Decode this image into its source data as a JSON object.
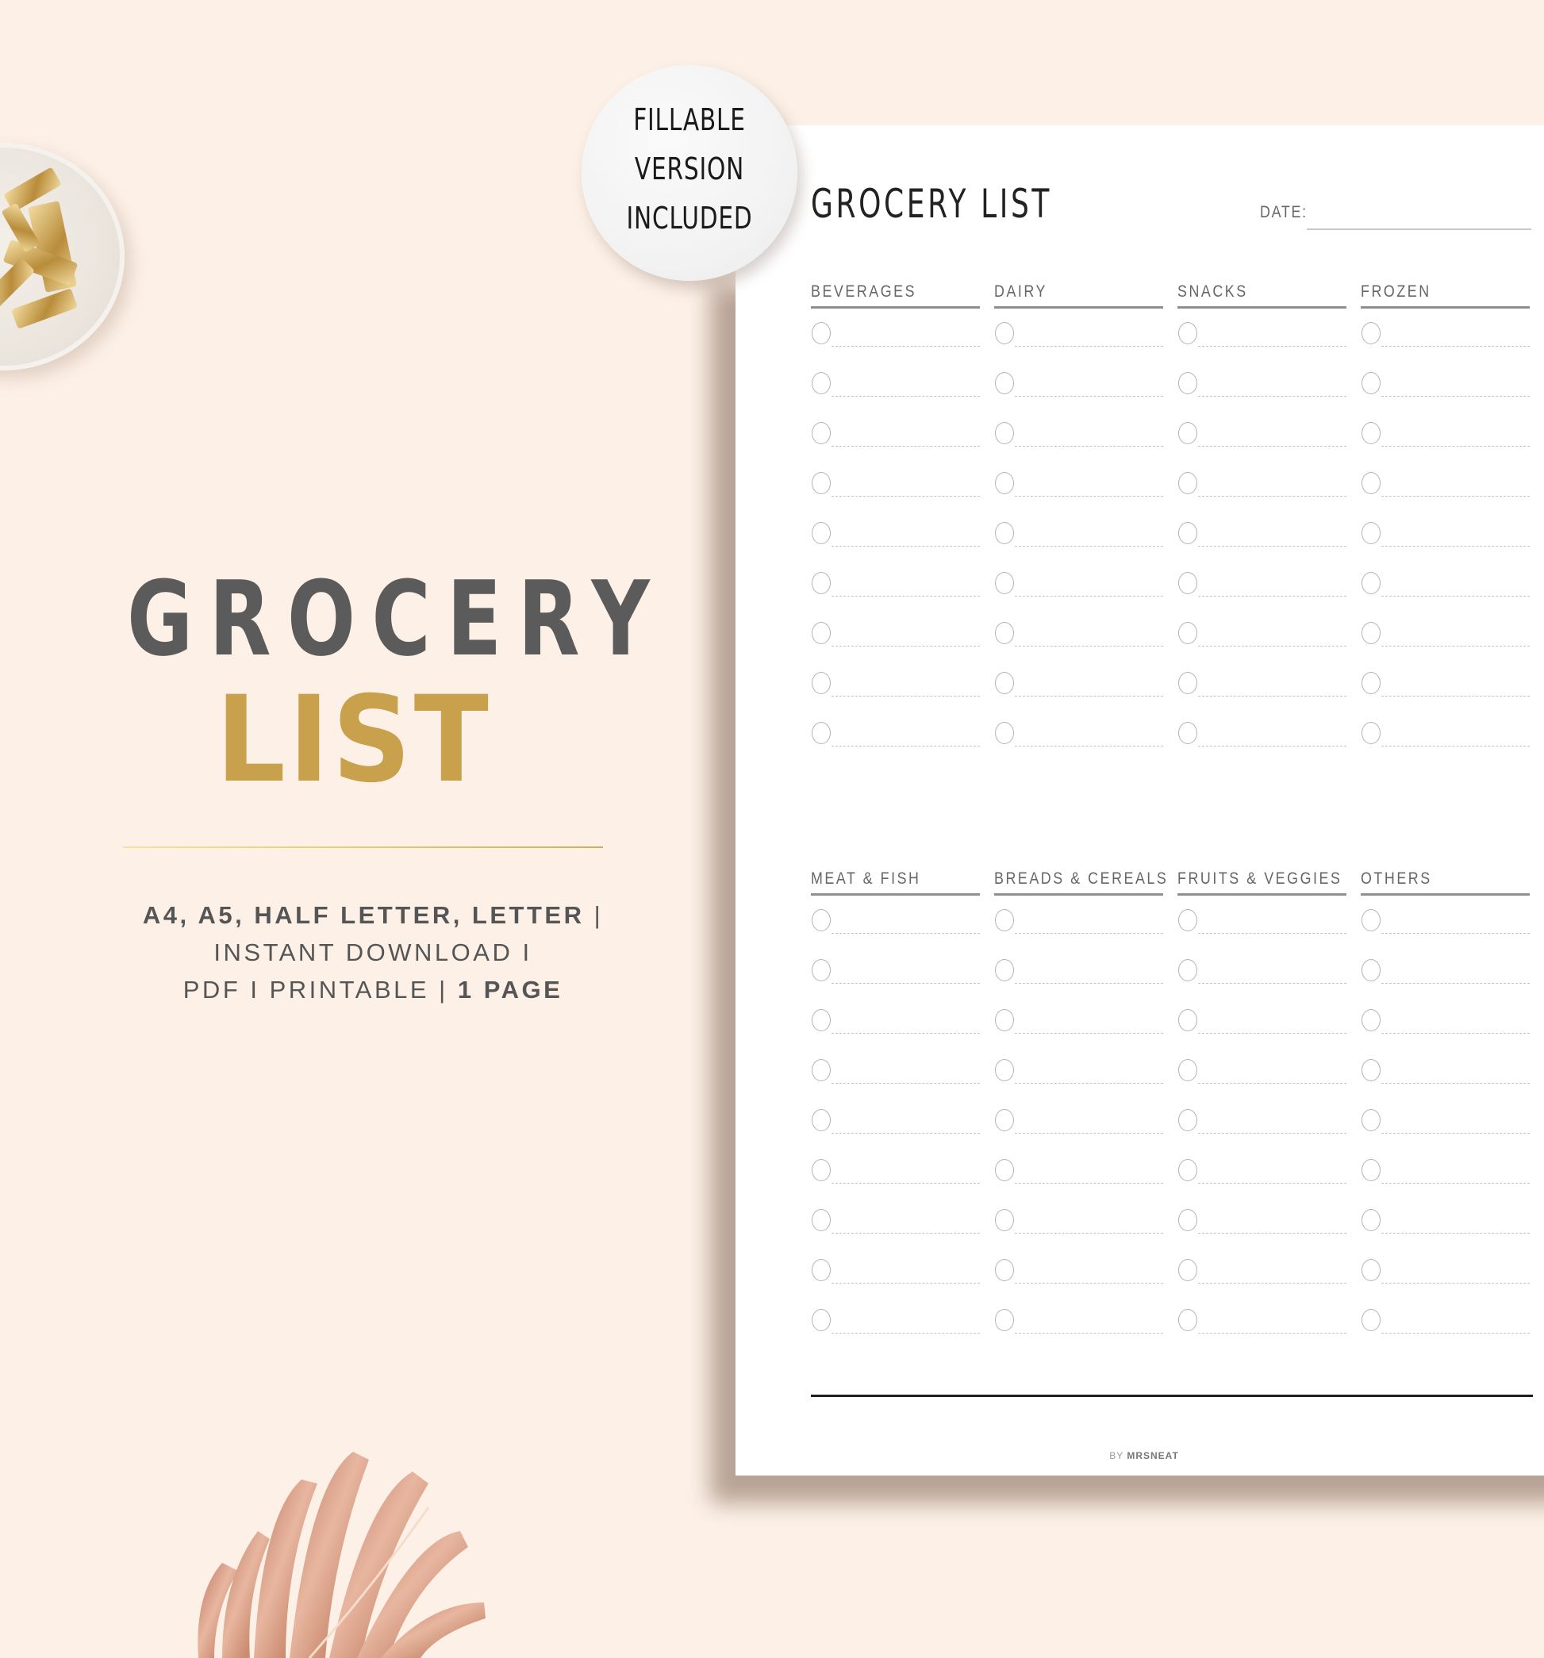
{
  "hero": {
    "title_line1": "GROCERY",
    "title_line2": "LIST",
    "formats_line1_bold": "A4, A5, HALF LETTER, LETTER",
    "formats_line1_sep": " |",
    "formats_line2": "INSTANT DOWNLOAD I",
    "formats_line3": "PDF I PRINTABLE | ",
    "formats_line3_bold": "1 PAGE",
    "accent_color": "#c9a04c",
    "title_color": "#5b5b5b"
  },
  "sticker": {
    "line1": "FILLABLE",
    "line2": "VERSION",
    "line3": "INCLUDED"
  },
  "planner": {
    "title": "GROCERY LIST",
    "date_label": "DATE:",
    "sections": [
      {
        "columns": [
          {
            "label": "BEVERAGES",
            "rows": 9
          },
          {
            "label": "DAIRY",
            "rows": 9
          },
          {
            "label": "SNACKS",
            "rows": 9
          },
          {
            "label": "FROZEN",
            "rows": 9
          }
        ]
      },
      {
        "columns": [
          {
            "label": "MEAT & FISH",
            "rows": 9
          },
          {
            "label": "BREADS & CEREALS",
            "rows": 9
          },
          {
            "label": "FRUITS & VEGGIES",
            "rows": 9
          },
          {
            "label": "OTHERS",
            "rows": 9
          }
        ]
      }
    ],
    "credit_prefix": "BY ",
    "credit_brand": "MRSNEAT"
  }
}
